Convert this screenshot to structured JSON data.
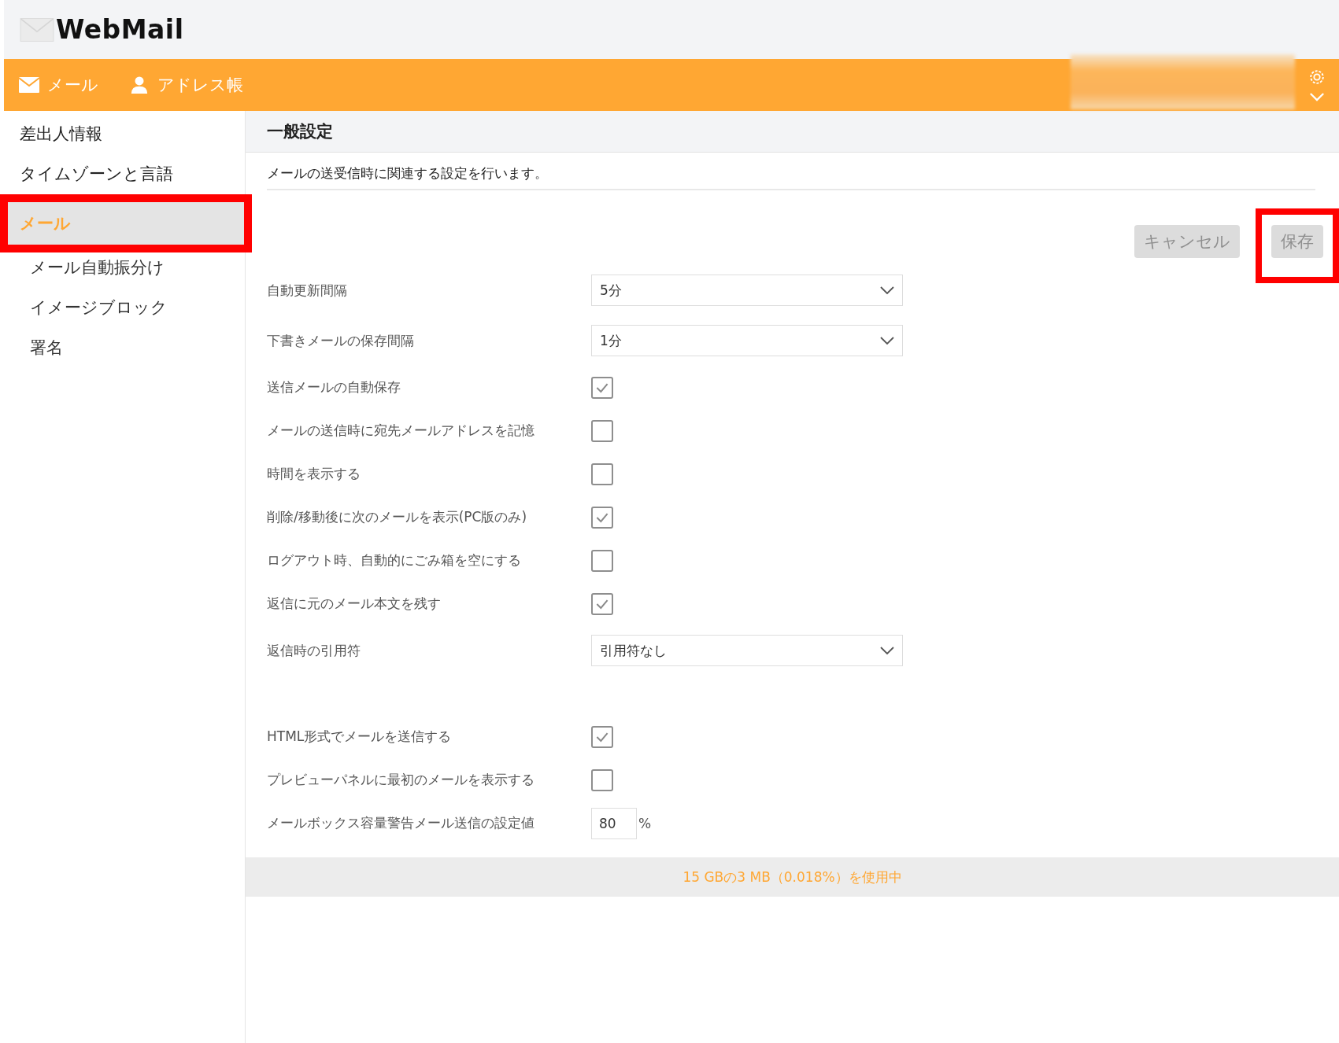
{
  "logo": {
    "text": "WebMail"
  },
  "nav": [
    {
      "label": "メール",
      "kind": "mail"
    },
    {
      "label": "アドレス帳",
      "kind": "contacts"
    }
  ],
  "sidebar": {
    "items": [
      {
        "label": "差出人情報",
        "selected": false,
        "highlighted": false
      },
      {
        "label": "タイムゾーンと言語",
        "selected": false,
        "highlighted": false
      },
      {
        "label": "メール",
        "selected": true,
        "highlighted": true,
        "children": [
          {
            "label": "メール自動振分け",
            "selected": false
          },
          {
            "label": "イメージブロック",
            "selected": false
          },
          {
            "label": "署名",
            "selected": false
          }
        ]
      }
    ]
  },
  "section": {
    "title": "一般設定",
    "description": "メールの送受信時に関連する設定を行います。"
  },
  "buttons": [
    {
      "label": "キャンセル",
      "disabled": true,
      "highlighted": false
    },
    {
      "label": "保存",
      "disabled": true,
      "highlighted": true
    }
  ],
  "settings_groups": [
    [
      {
        "label": "自動更新間隔",
        "kind": "select",
        "value": "5分"
      },
      {
        "label": "下書きメールの保存間隔",
        "kind": "select",
        "value": "1分"
      },
      {
        "label": "送信メールの自動保存",
        "kind": "checkbox",
        "checked": true
      },
      {
        "label": "メールの送信時に宛先メールアドレスを記憶",
        "kind": "checkbox",
        "checked": false
      },
      {
        "label": "時間を表示する",
        "kind": "checkbox",
        "checked": false
      },
      {
        "label": "削除/移動後に次のメールを表示(PC版のみ)",
        "kind": "checkbox",
        "checked": true
      },
      {
        "label": "ログアウト時、自動的にごみ箱を空にする",
        "kind": "checkbox",
        "checked": false
      },
      {
        "label": "返信に元のメール本文を残す",
        "kind": "checkbox",
        "checked": true
      },
      {
        "label": "返信時の引用符",
        "kind": "select",
        "value": "引用符なし"
      }
    ],
    [
      {
        "label": "HTML形式でメールを送信する",
        "kind": "checkbox",
        "checked": true
      },
      {
        "label": "プレビューパネルに最初のメールを表示する",
        "kind": "checkbox",
        "checked": false
      },
      {
        "label": "メールボックス容量警告メール送信の設定値",
        "kind": "number",
        "value": "80",
        "unit": "%"
      }
    ]
  ],
  "usage": {
    "text": "15 GBの3 MB（0.018%）を使用中"
  }
}
